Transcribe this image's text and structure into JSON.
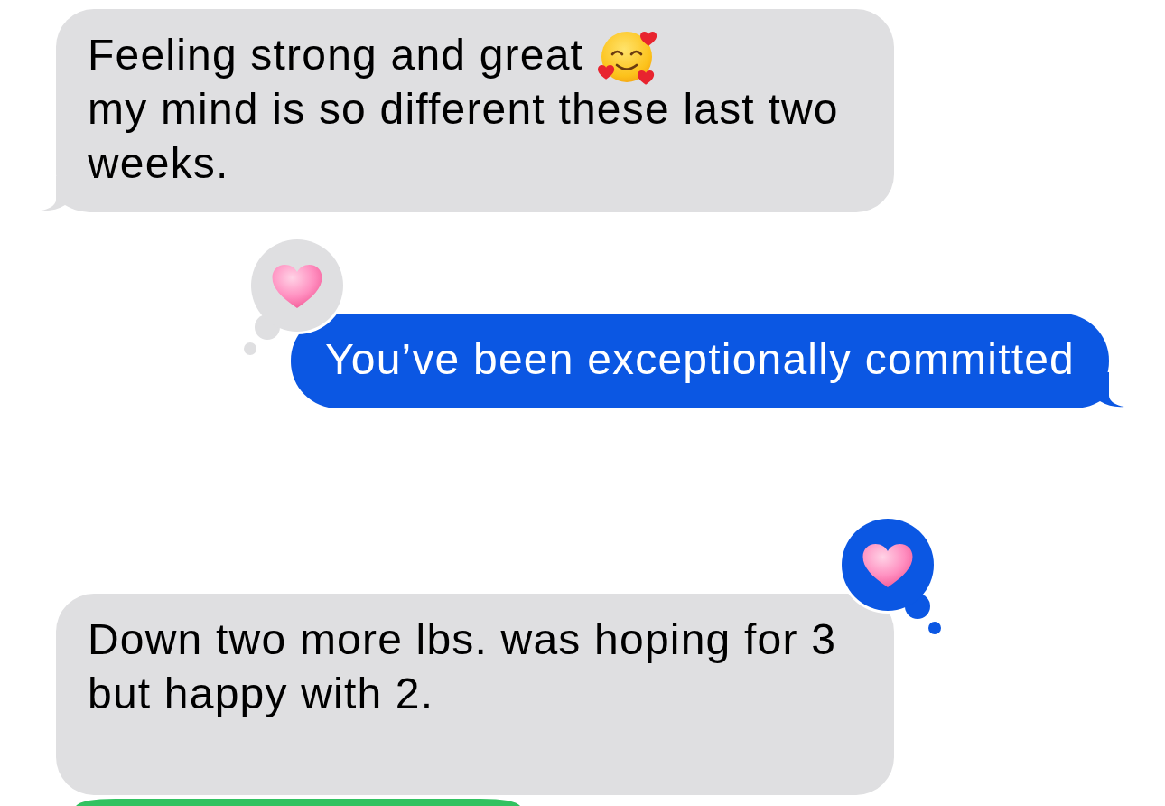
{
  "messages": [
    {
      "kind": "incoming",
      "color": "#dfdfe1",
      "tail": true,
      "lines": [
        {
          "text": "Feeling strong and great",
          "emoji": true
        },
        {
          "text": "my mind is so different these last two weeks.",
          "emoji": false
        }
      ]
    },
    {
      "kind": "outgoing",
      "color": "#0b57e3",
      "tail": true,
      "lines": [
        {
          "text": "You’ve been exceptionally committed",
          "emoji": false
        }
      ],
      "reaction": {
        "from_me": false
      }
    },
    {
      "kind": "incoming",
      "color": "#dfdfe1",
      "tail": false,
      "lines": [
        {
          "text": "Down two more lbs. was hoping for 3 but happy with 2.",
          "emoji": false
        }
      ],
      "reaction": {
        "from_me": true
      }
    },
    {
      "kind": "incoming",
      "color": "#32c261"
    }
  ]
}
